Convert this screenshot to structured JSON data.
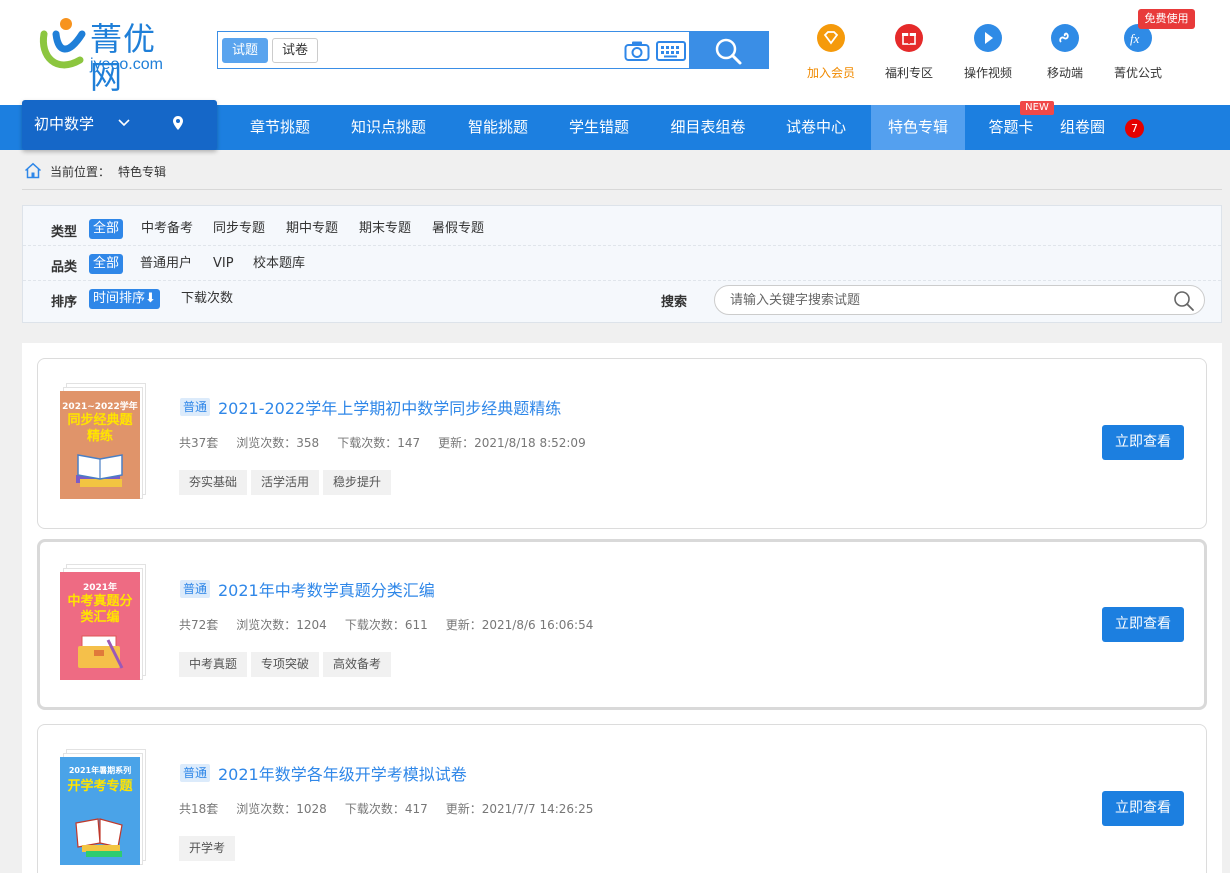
{
  "header": {
    "logo": {
      "name": "菁优网",
      "url": "jyeoo.com"
    },
    "search": {
      "tab_active": "试题",
      "tab_other": "试卷"
    },
    "quick_links": [
      {
        "label": "加入会员",
        "icon": "vip-diamond-icon",
        "color": "#f59a0b"
      },
      {
        "label": "福利专区",
        "icon": "gift-icon",
        "color": "#e52a2a"
      },
      {
        "label": "操作视频",
        "icon": "play-icon",
        "color": "#2f8be6"
      },
      {
        "label": "移动端",
        "icon": "mobile-icon",
        "color": "#2f8be6"
      },
      {
        "label": "菁优公式",
        "icon": "formula-icon",
        "color": "#2f8be6"
      }
    ],
    "free_badge": "免费使用"
  },
  "nav": {
    "subject": "初中数学",
    "items": [
      "章节挑题",
      "知识点挑题",
      "智能挑题",
      "学生错题",
      "细目表组卷",
      "试卷中心",
      "特色专辑",
      "答题卡",
      "组卷圈"
    ],
    "active": "特色专辑",
    "new_badge": "NEW",
    "count": "7"
  },
  "breadcrumb": {
    "prefix": "当前位置：",
    "current": "特色专辑"
  },
  "filters": {
    "type": {
      "label": "类型",
      "options": [
        "全部",
        "中考备考",
        "同步专题",
        "期中专题",
        "期末专题",
        "暑假专题"
      ],
      "selected": "全部"
    },
    "category": {
      "label": "品类",
      "options": [
        "全部",
        "普通用户",
        "VIP",
        "校本题库"
      ],
      "selected": "全部"
    },
    "sort": {
      "label": "排序",
      "options": [
        "时间排序⬇",
        "下载次数"
      ],
      "selected": "时间排序⬇"
    },
    "search": {
      "label": "搜索",
      "placeholder": "请输入关键字搜索试题"
    }
  },
  "cards": [
    {
      "badge": "普通",
      "title": "2021-2022学年上学期初中数学同步经典题精练",
      "sets": "共37套",
      "views": "浏览次数：358",
      "downloads": "下载次数：147",
      "updated": "更新：2021/8/18 8:52:09",
      "tags": [
        "夯实基础",
        "活学活用",
        "稳步提升"
      ],
      "cover_top": "2021~2022学年",
      "cover_title": "同步经典题精练",
      "cover_color": "#e0946a",
      "button": "立即查看"
    },
    {
      "badge": "普通",
      "title": "2021年中考数学真题分类汇编",
      "sets": "共72套",
      "views": "浏览次数：1204",
      "downloads": "下载次数：611",
      "updated": "更新：2021/8/6 16:06:54",
      "tags": [
        "中考真题",
        "专项突破",
        "高效备考"
      ],
      "cover_top": "2021年",
      "cover_title": "中考真题分类汇编",
      "cover_color": "#ee6b83",
      "button": "立即查看"
    },
    {
      "badge": "普通",
      "title": "2021年数学各年级开学考模拟试卷",
      "sets": "共18套",
      "views": "浏览次数：1028",
      "downloads": "下载次数：417",
      "updated": "更新：2021/7/7 14:26:25",
      "tags": [
        "开学考"
      ],
      "cover_top": "2021年暑期系列",
      "cover_title": "开学考专题",
      "cover_color": "#4aa3e8",
      "button": "立即查看"
    }
  ]
}
